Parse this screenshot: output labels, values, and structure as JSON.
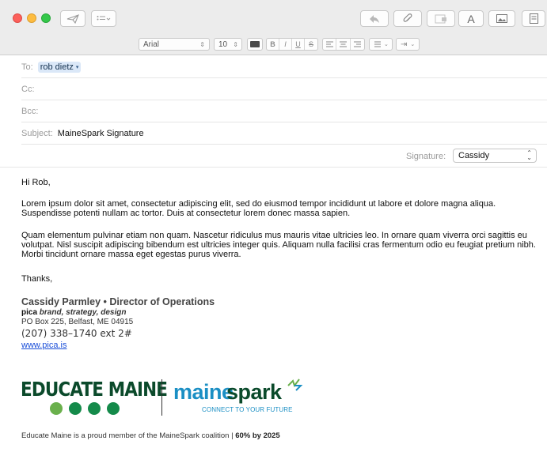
{
  "window": {
    "toolbar_icons": [
      "send-icon",
      "list-icon",
      "reply-icon",
      "attach-icon",
      "header-fields-icon",
      "font-icon",
      "photo-browser-icon",
      "template-icon"
    ]
  },
  "format_bar": {
    "font_family": "Arial",
    "font_size": "10",
    "bold": "B",
    "italic": "I",
    "underline": "U",
    "strikethrough": "S",
    "indent_label": "⇥"
  },
  "header": {
    "to_label": "To:",
    "to_recipient": "rob dietz",
    "cc_label": "Cc:",
    "bcc_label": "Bcc:",
    "subject_label": "Subject:",
    "subject_value": "MaineSpark Signature",
    "signature_label": "Signature:",
    "signature_value": "Cassidy"
  },
  "body": {
    "greeting": "Hi Rob,",
    "paragraph1": "Lorem ipsum dolor sit amet, consectetur adipiscing elit, sed do eiusmod tempor incididunt ut labore et dolore magna aliqua. Suspendisse potenti nullam ac tortor. Duis at consectetur lorem donec massa sapien.",
    "paragraph2": "Quam elementum pulvinar etiam non quam. Nascetur ridiculus mus mauris vitae ultricies leo. In ornare quam viverra orci sagittis eu volutpat. Nisl suscipit adipiscing bibendum est ultricies integer quis. Aliquam nulla facilisi cras fermentum odio eu feugiat pretium nibh. Morbi tincidunt ornare massa eget egestas purus viverra.",
    "closing": "Thanks,"
  },
  "signature": {
    "name_title": "Cassidy Parmley • Director of Operations",
    "company": "pica",
    "tagline": "brand, strategy, design",
    "address": "PO Box 225, Belfast, ME 04915",
    "phone": "(207) 338–1740 ext 2#",
    "website": "www.pica.is"
  },
  "logos": {
    "educate_maine": "EDUCATE MAINE",
    "mainespark_part1": "maine",
    "mainespark_part2": "spark",
    "mainespark_tagline": "CONNECT TO  YOUR FUTURE",
    "colors": {
      "maine_blue": "#1b8fc4",
      "dark_green": "#0b4a2b",
      "light_green": "#6ab04c"
    }
  },
  "footer": {
    "text": "Educate Maine is a proud member of the MaineSpark coalition |",
    "bold": "60% by 2025"
  }
}
